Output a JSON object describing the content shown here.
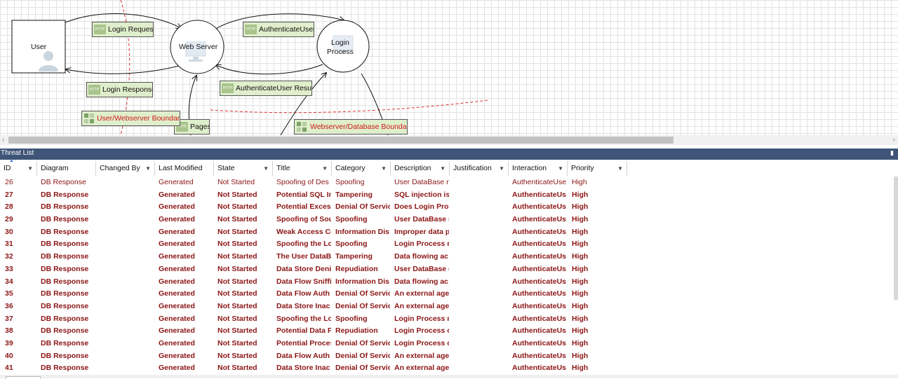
{
  "diagram": {
    "nodes": {
      "user": "User",
      "web_server": "Web Server",
      "login_process": "Login\nProcess"
    },
    "flows": {
      "login_request": "Login Request",
      "login_response": "Login Response",
      "authenticate_user": "AuthenticateUser",
      "authenticate_user_result": "AuthenticateUser Result",
      "pages": "Pages"
    },
    "boundaries": {
      "user_webserver": "User/Webserver Boundary",
      "webserver_database": "Webserver/Database Boundary"
    },
    "icons": {
      "flow_icon": "http-icon",
      "boundary_icon": "boundary-icon",
      "user_icon": "person-icon",
      "server_icon": "monitor-icon"
    },
    "colors": {
      "flow_fill": "#dfeecb",
      "boundary_text": "#d01818",
      "header_bar": "#3e5577",
      "row_text": "#8c1515"
    }
  },
  "threat_list": {
    "title": "Threat List",
    "pin_icon": "pin-icon",
    "columns": [
      "ID",
      "Diagram",
      "Changed By",
      "Last Modified",
      "State",
      "Title",
      "Category",
      "Description",
      "Justification",
      "Interaction",
      "Priority"
    ],
    "rows": [
      {
        "id": "26",
        "diagram": "DB Response",
        "changed_by": "",
        "last_modified": "Generated",
        "state": "Not Started",
        "title": "Spoofing of Des",
        "category": "Spoofing",
        "description": "User DataBase n",
        "justification": "",
        "interaction": "AuthenticateUse",
        "priority": "High"
      },
      {
        "id": "27",
        "diagram": "DB Response",
        "changed_by": "",
        "last_modified": "Generated",
        "state": "Not Started",
        "title": "Potential SQL In",
        "category": "Tampering",
        "description": "SQL injection is",
        "justification": "",
        "interaction": "AuthenticateUs",
        "priority": "High"
      },
      {
        "id": "28",
        "diagram": "DB Response",
        "changed_by": "",
        "last_modified": "Generated",
        "state": "Not Started",
        "title": "Potential Excess",
        "category": "Denial Of Servic",
        "description": "Does Login Proc",
        "justification": "",
        "interaction": "AuthenticateUs",
        "priority": "High"
      },
      {
        "id": "29",
        "diagram": "DB Response",
        "changed_by": "",
        "last_modified": "Generated",
        "state": "Not Started",
        "title": "Spoofing of Sou",
        "category": "Spoofing",
        "description": "User DataBase n",
        "justification": "",
        "interaction": "AuthenticateUs",
        "priority": "High"
      },
      {
        "id": "30",
        "diagram": "DB Response",
        "changed_by": "",
        "last_modified": "Generated",
        "state": "Not Started",
        "title": "Weak Access Co",
        "category": "Information Dis",
        "description": "Improper data p",
        "justification": "",
        "interaction": "AuthenticateUs",
        "priority": "High"
      },
      {
        "id": "31",
        "diagram": "DB Response",
        "changed_by": "",
        "last_modified": "Generated",
        "state": "Not Started",
        "title": "Spoofing the Lo",
        "category": "Spoofing",
        "description": "Login Process m",
        "justification": "",
        "interaction": "AuthenticateUs",
        "priority": "High"
      },
      {
        "id": "32",
        "diagram": "DB Response",
        "changed_by": "",
        "last_modified": "Generated",
        "state": "Not Started",
        "title": "The User DataB",
        "category": "Tampering",
        "description": "Data flowing ac",
        "justification": "",
        "interaction": "AuthenticateUs",
        "priority": "High"
      },
      {
        "id": "33",
        "diagram": "DB Response",
        "changed_by": "",
        "last_modified": "Generated",
        "state": "Not Started",
        "title": "Data Store Deni",
        "category": "Repudiation",
        "description": "User DataBase c",
        "justification": "",
        "interaction": "AuthenticateUs",
        "priority": "High"
      },
      {
        "id": "34",
        "diagram": "DB Response",
        "changed_by": "",
        "last_modified": "Generated",
        "state": "Not Started",
        "title": "Data Flow Sniffi",
        "category": "Information Dis",
        "description": "Data flowing ac",
        "justification": "",
        "interaction": "AuthenticateUs",
        "priority": "High"
      },
      {
        "id": "35",
        "diagram": "DB Response",
        "changed_by": "",
        "last_modified": "Generated",
        "state": "Not Started",
        "title": "Data Flow Auth",
        "category": "Denial Of Servic",
        "description": "An external age",
        "justification": "",
        "interaction": "AuthenticateUs",
        "priority": "High"
      },
      {
        "id": "36",
        "diagram": "DB Response",
        "changed_by": "",
        "last_modified": "Generated",
        "state": "Not Started",
        "title": "Data Store Inac",
        "category": "Denial Of Servic",
        "description": "An external age",
        "justification": "",
        "interaction": "AuthenticateUs",
        "priority": "High"
      },
      {
        "id": "37",
        "diagram": "DB Response",
        "changed_by": "",
        "last_modified": "Generated",
        "state": "Not Started",
        "title": "Spoofing the Lo",
        "category": "Spoofing",
        "description": "Login Process m",
        "justification": "",
        "interaction": "AuthenticateUs",
        "priority": "High"
      },
      {
        "id": "38",
        "diagram": "DB Response",
        "changed_by": "",
        "last_modified": "Generated",
        "state": "Not Started",
        "title": "Potential Data F",
        "category": "Repudiation",
        "description": "Login Process cl",
        "justification": "",
        "interaction": "AuthenticateUs",
        "priority": "High"
      },
      {
        "id": "39",
        "diagram": "DB Response",
        "changed_by": "",
        "last_modified": "Generated",
        "state": "Not Started",
        "title": "Potential Proces",
        "category": "Denial Of Servic",
        "description": "Login Process cr",
        "justification": "",
        "interaction": "AuthenticateUs",
        "priority": "High"
      },
      {
        "id": "40",
        "diagram": "DB Response",
        "changed_by": "",
        "last_modified": "Generated",
        "state": "Not Started",
        "title": "Data Flow Auth",
        "category": "Denial Of Servic",
        "description": "An external age",
        "justification": "",
        "interaction": "AuthenticateUs",
        "priority": "High"
      },
      {
        "id": "41",
        "diagram": "DB Response",
        "changed_by": "",
        "last_modified": "Generated",
        "state": "Not Started",
        "title": "Data Store Inac",
        "category": "Denial Of Servic",
        "description": "An external age",
        "justification": "",
        "interaction": "AuthenticateUs",
        "priority": "High"
      }
    ]
  }
}
